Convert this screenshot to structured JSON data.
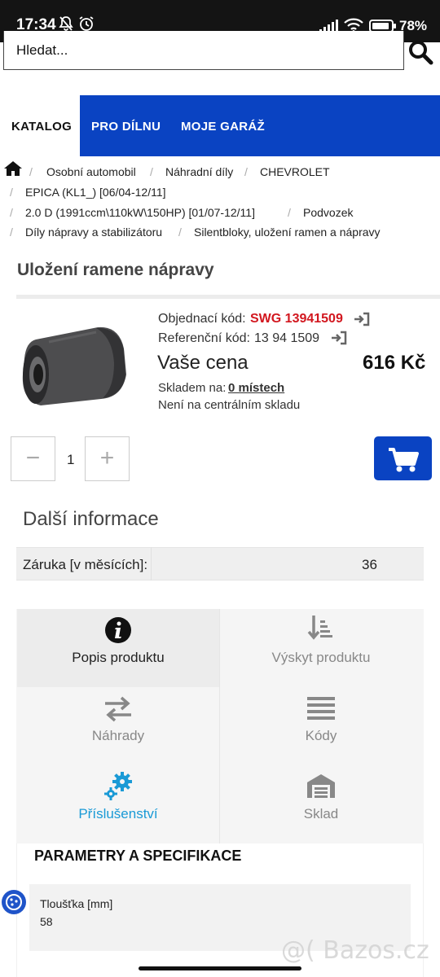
{
  "status_bar": {
    "time": "17:34",
    "battery": "78%"
  },
  "search": {
    "placeholder": "Hledat..."
  },
  "nav": {
    "items": [
      "KATALOG",
      "PRO DÍLNU",
      "MOJE GARÁŽ"
    ]
  },
  "breadcrumb": [
    "Osobní automobil",
    "Náhradní díly",
    "CHEVROLET",
    "EPICA (KL1_) [06/04-12/11]",
    "2.0 D (1991ccm\\110kW\\150HP) [01/07-12/11]",
    "Podvozek",
    "Díly nápravy a stabilizátoru",
    "Silentbloky, uložení ramen a nápravy"
  ],
  "page_title": "Uložení ramene nápravy",
  "product": {
    "order_code_label": "Objednací kód:",
    "order_code": "SWG 13941509",
    "ref_code_label": "Referenční kód:",
    "ref_code": "13 94 1509",
    "price_label": "Vaše cena",
    "price": "616 Kč",
    "stock_label": "Skladem na:",
    "stock_value": "0 místech",
    "central_stock": "Není na centrálním skladu"
  },
  "quantity": {
    "minus": "−",
    "value": "1",
    "plus": "+"
  },
  "more_info": {
    "title": "Další informace",
    "rows": [
      {
        "label": "Záruka [v měsících]:",
        "value": "36"
      }
    ]
  },
  "tiles": [
    {
      "label": "Popis produktu",
      "icon": "info-icon"
    },
    {
      "label": "Výskyt produktu",
      "icon": "sort-icon"
    },
    {
      "label": "Náhrady",
      "icon": "exchange-icon"
    },
    {
      "label": "Kódy",
      "icon": "list-icon"
    },
    {
      "label": "Příslušenství",
      "icon": "gears-icon"
    },
    {
      "label": "Sklad",
      "icon": "warehouse-icon"
    }
  ],
  "params": {
    "title": "PARAMETRY A SPECIFIKACE",
    "rows": [
      {
        "label": "Tloušťka [mm]",
        "value": "58"
      }
    ]
  },
  "watermark": "@( Bazos.cz",
  "colors": {
    "brand_blue": "#0a43c2",
    "code_red": "#d2171f",
    "accent_link": "#1a9ad6"
  }
}
